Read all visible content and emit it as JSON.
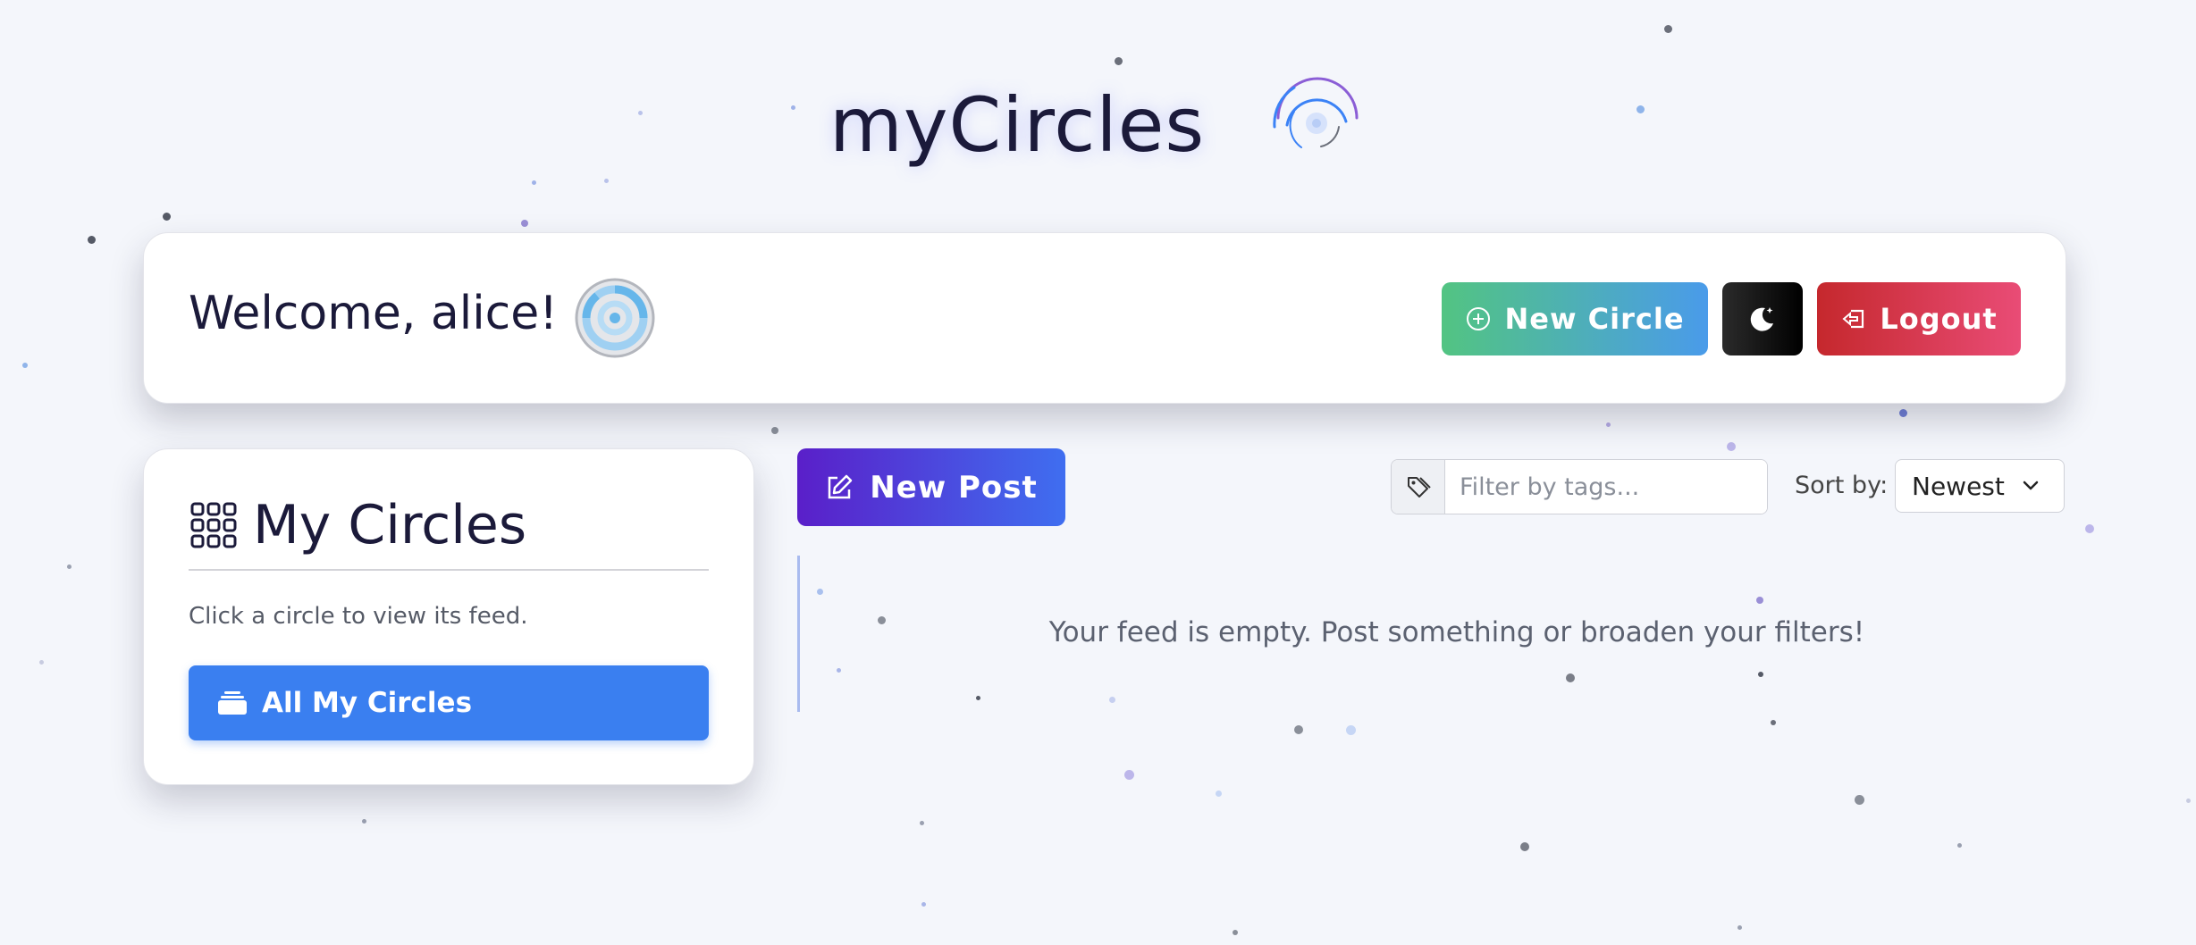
{
  "brand": {
    "title": "myCircles"
  },
  "header": {
    "welcome": "Welcome, alice!",
    "new_circle_label": "New Circle",
    "logout_label": "Logout"
  },
  "sidebar": {
    "title": "My Circles",
    "hint": "Click a circle to view its feed.",
    "all_circles_label": "All My Circles"
  },
  "feed": {
    "new_post_label": "New Post",
    "filter_placeholder": "Filter by tags...",
    "sort_label": "Sort by:",
    "sort_value": "Newest",
    "empty_message": "Your feed is empty. Post something or broaden your filters!"
  },
  "colors": {
    "background": "#f4f6fb",
    "new_circle_gradient": [
      "#52c482",
      "#4a9bea"
    ],
    "logout_gradient": [
      "#c5282d",
      "#e94c76"
    ],
    "new_post_gradient": [
      "#5a1fc9",
      "#3f6ef0"
    ],
    "all_circles": "#3a7ff0"
  }
}
